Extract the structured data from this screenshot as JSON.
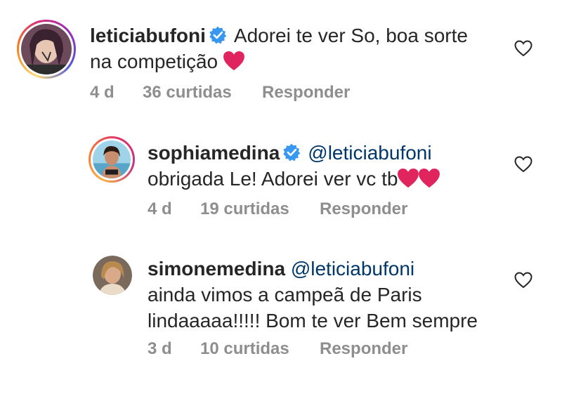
{
  "comments": [
    {
      "username": "leticiabufoni",
      "verified": true,
      "mention": "",
      "text_line1": "Adorei te ver So, boa sorte",
      "text_line2": "na competição",
      "time": "4 d",
      "likes": "36 curtidas",
      "reply": "Responder"
    },
    {
      "username": "sophiamedina",
      "verified": true,
      "mention": "@leticiabufoni",
      "text_line1": "obrigada Le! Adorei ver vc tb",
      "time": "4 d",
      "likes": "19 curtidas",
      "reply": "Responder"
    },
    {
      "username": "simonemedina",
      "verified": false,
      "mention": "@leticiabufoni",
      "text_line1": "ainda vimos a campeã de Paris",
      "text_line2": "lindaaaaa!!!!! Bom te ver Bem sempre",
      "time": "3 d",
      "likes": "10 curtidas",
      "reply": "Responder"
    }
  ],
  "icons": {
    "verified": "verified-badge-icon",
    "heart_emoji": "red-heart-emoji",
    "like": "heart-outline-icon"
  },
  "colors": {
    "verified_blue": "#3897f0",
    "heart_red": "#e0245e",
    "meta_gray": "#8e8e8e",
    "mention_blue": "#00376b"
  }
}
